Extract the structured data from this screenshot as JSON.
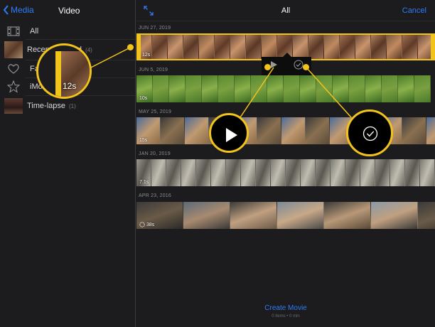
{
  "sidebar": {
    "back_label": "Media",
    "title": "Video",
    "items": [
      {
        "label": "All",
        "count": ""
      },
      {
        "label": "Recently Added",
        "count": "(4)"
      },
      {
        "label": "Favorites",
        "count": ""
      },
      {
        "label": "iMovie Theater",
        "count": ""
      },
      {
        "label": "Time-lapse",
        "count": "(1)"
      }
    ]
  },
  "main": {
    "title": "All",
    "cancel_label": "Cancel",
    "groups": [
      {
        "date": "JUN 27, 2019",
        "duration": "12s",
        "selected": true
      },
      {
        "date": "JUN 5, 2019",
        "duration": "10s"
      },
      {
        "date": "MAY 25, 2019",
        "duration": "15s"
      },
      {
        "date": "JAN 20, 2019",
        "duration": "7.1s"
      },
      {
        "date": "APR 23, 2016",
        "duration": "38s",
        "icon": "slow-motion-icon"
      }
    ]
  },
  "callouts": {
    "handle_duration": "12s"
  },
  "footer": {
    "create_label": "Create Movie",
    "sub_label": "0 items • 0 min"
  },
  "colors": {
    "accent": "#2f7cf6",
    "highlight": "#f2c31b",
    "background": "#1c1c1e"
  }
}
